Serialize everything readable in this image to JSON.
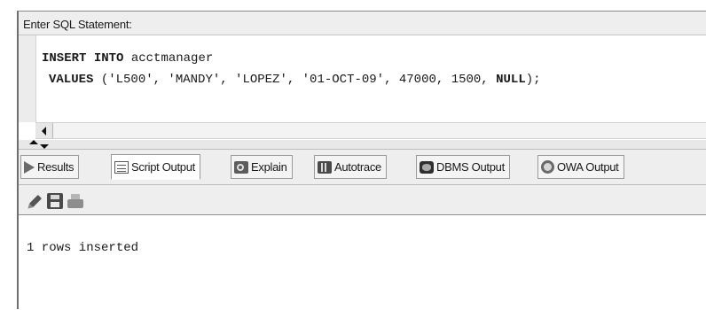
{
  "sql_panel": {
    "header_label": "Enter SQL Statement:",
    "code": {
      "line1_keyword1": "INSERT",
      "line1_keyword2": "INTO",
      "line1_rest": " acctmanager",
      "line2_keyword": "VALUES",
      "line2_values": " ('L500', 'MANDY', 'LOPEZ', '01-OCT-09', 47000, 1500, ",
      "line2_null": "NULL",
      "line2_end": ");"
    }
  },
  "tabs": [
    {
      "label": "Results",
      "icon": "results-icon",
      "active": false
    },
    {
      "label": "Script Output",
      "icon": "script-output-icon",
      "active": true
    },
    {
      "label": "Explain",
      "icon": "explain-icon",
      "active": false
    },
    {
      "label": "Autotrace",
      "icon": "autotrace-icon",
      "active": false
    },
    {
      "label": "DBMS Output",
      "icon": "dbms-output-icon",
      "active": false
    },
    {
      "label": "OWA Output",
      "icon": "owa-output-icon",
      "active": false
    }
  ],
  "toolbar": {
    "icons": [
      "clear-pencil-icon",
      "save-icon",
      "print-icon"
    ]
  },
  "output": {
    "message": "1 rows inserted"
  }
}
